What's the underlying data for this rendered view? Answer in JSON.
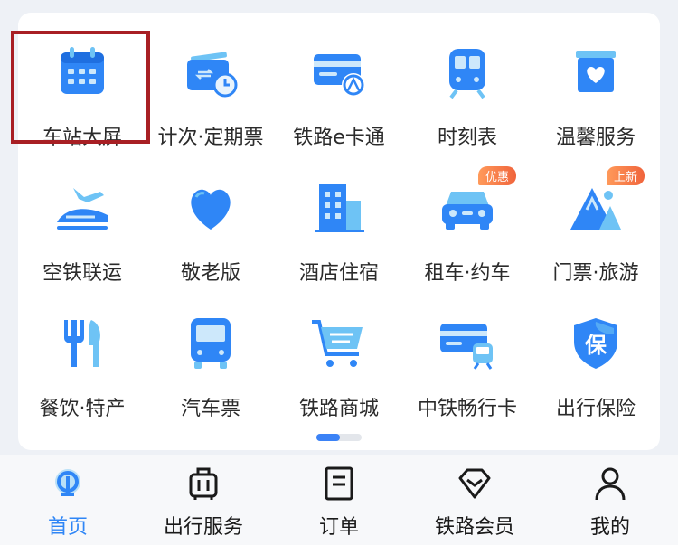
{
  "grid_items": [
    {
      "label": "车站大屏",
      "icon": "calendar-icon",
      "selected": true
    },
    {
      "label": "计次·定期票",
      "icon": "ticket-clock-icon"
    },
    {
      "label": "铁路e卡通",
      "icon": "railway-card-icon"
    },
    {
      "label": "时刻表",
      "icon": "train-icon"
    },
    {
      "label": "温馨服务",
      "icon": "heart-box-icon"
    },
    {
      "label": "空铁联运",
      "icon": "plane-train-icon"
    },
    {
      "label": "敬老版",
      "icon": "heart-icon"
    },
    {
      "label": "酒店住宿",
      "icon": "hotel-icon"
    },
    {
      "label": "租车·约车",
      "icon": "car-icon",
      "badge": "优惠"
    },
    {
      "label": "门票·旅游",
      "icon": "mountain-icon",
      "badge": "上新"
    },
    {
      "label": "餐饮·特产",
      "icon": "fork-knife-icon"
    },
    {
      "label": "汽车票",
      "icon": "bus-icon"
    },
    {
      "label": "铁路商城",
      "icon": "cart-icon"
    },
    {
      "label": "中铁畅行卡",
      "icon": "card-train-icon"
    },
    {
      "label": "出行保险",
      "icon": "insurance-shield-icon"
    }
  ],
  "pager": {
    "pages": 2,
    "current": 1
  },
  "tabbar": [
    {
      "label": "首页",
      "icon": "railway-logo-icon",
      "active": true
    },
    {
      "label": "出行服务",
      "icon": "luggage-icon"
    },
    {
      "label": "订单",
      "icon": "document-icon"
    },
    {
      "label": "铁路会员",
      "icon": "diamond-icon"
    },
    {
      "label": "我的",
      "icon": "person-icon"
    }
  ],
  "colors": {
    "accent": "#2f86f6",
    "icon_light": "#6ec3f5",
    "selection_border": "#a81f24",
    "badge": "#f0643c"
  }
}
